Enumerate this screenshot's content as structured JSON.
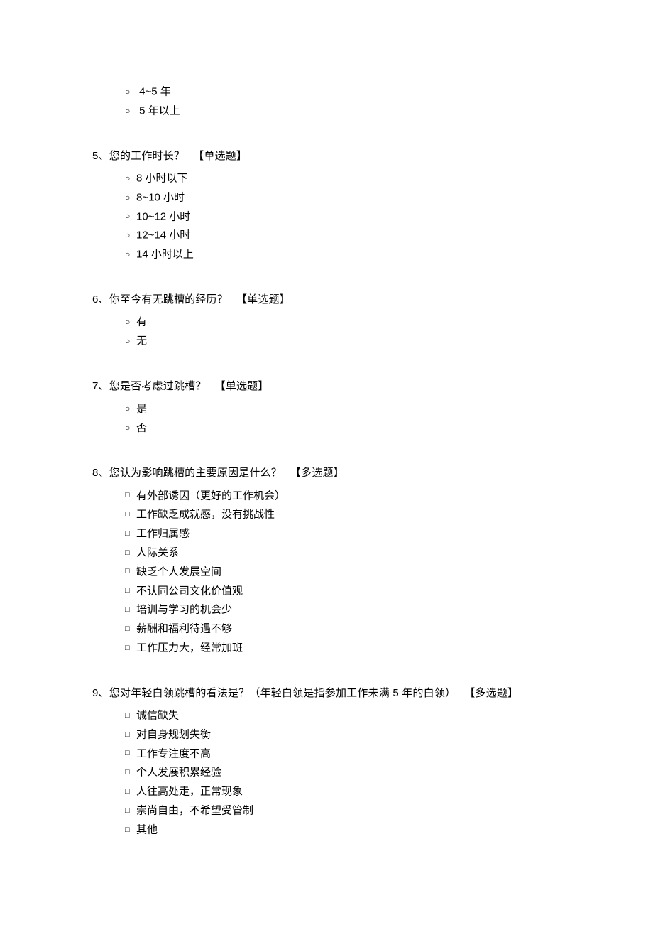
{
  "leftover": {
    "marker": "○",
    "options": [
      "4~5 年",
      "5 年以上"
    ]
  },
  "questions": [
    {
      "number": "5、",
      "text": "您的工作时长？",
      "tag": "【单选题】",
      "type": "radio",
      "marker": "○",
      "options": [
        "8 小时以下",
        "8~10 小时",
        "10~12 小时",
        "12~14 小时",
        "14 小时以上"
      ]
    },
    {
      "number": "6、",
      "text": "你至今有无跳槽的经历？",
      "tag": "【单选题】",
      "type": "radio",
      "marker": "○",
      "options": [
        "有",
        "无"
      ]
    },
    {
      "number": "7、",
      "text": "您是否考虑过跳槽？",
      "tag": "【单选题】",
      "type": "radio",
      "marker": "○",
      "options": [
        "是",
        "否"
      ]
    },
    {
      "number": "8、",
      "text": "您认为影响跳槽的主要原因是什么？",
      "tag": "【多选题】",
      "type": "checkbox",
      "marker": "□",
      "options": [
        "有外部诱因（更好的工作机会）",
        "工作缺乏成就感，没有挑战性",
        "工作归属感",
        "人际关系",
        "缺乏个人发展空间",
        "不认同公司文化价值观",
        "培训与学习的机会少",
        "薪酬和福利待遇不够",
        "工作压力大，经常加班"
      ]
    },
    {
      "number": "9、",
      "text": "您对年轻白领跳槽的看法是？（年轻白领是指参加工作未满 5 年的白领）",
      "tag": "【多选题】",
      "type": "checkbox",
      "marker": "□",
      "options": [
        "诚信缺失",
        "对自身规划失衡",
        "工作专注度不高",
        "个人发展积累经验",
        "人往高处走，正常现象",
        "崇尚自由，不希望受管制",
        "其他"
      ]
    }
  ]
}
